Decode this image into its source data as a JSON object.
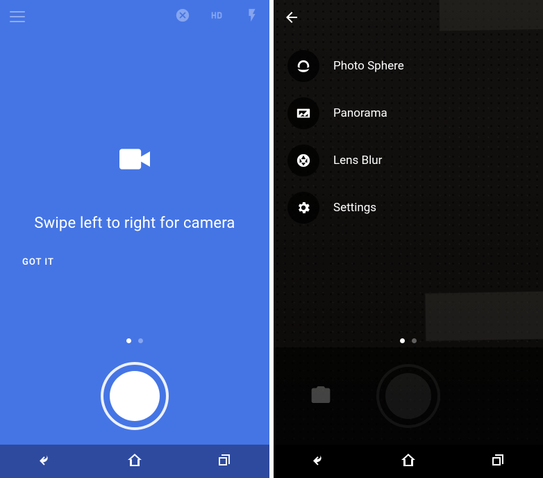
{
  "left": {
    "hint": "Swipe left to right for camera",
    "confirm": "GOT IT",
    "topbar": {
      "menu_icon": "hamburger-icon",
      "actions": [
        "no-flash-icon",
        "hdr-icon",
        "flash-icon"
      ]
    },
    "page_dots": {
      "count": 2,
      "active_index": 0
    },
    "navbar": {
      "back": "back",
      "home": "home",
      "recents": "recents"
    }
  },
  "right": {
    "back_label": "Back",
    "menu": [
      {
        "icon": "photosphere-icon",
        "label": "Photo Sphere"
      },
      {
        "icon": "panorama-icon",
        "label": "Panorama"
      },
      {
        "icon": "lensblur-icon",
        "label": "Lens Blur"
      },
      {
        "icon": "settings-icon",
        "label": "Settings"
      }
    ],
    "page_dots": {
      "count": 2,
      "active_index": 0
    },
    "navbar": {
      "back": "back",
      "home": "home",
      "recents": "recents"
    }
  },
  "colors": {
    "accent_blue": "#4a78e7",
    "nav_blue": "#2e4a9e",
    "black": "#000000",
    "white": "#ffffff"
  }
}
